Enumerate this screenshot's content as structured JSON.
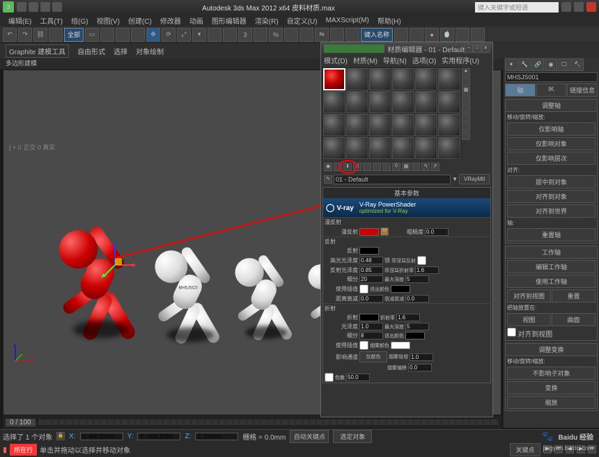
{
  "title": "Autodesk 3ds Max  2012 x64   皮料材质.max",
  "searchbox": "键入关键字或短语",
  "menubar": [
    "编辑(E)",
    "工具(T)",
    "组(G)",
    "视图(V)",
    "创建(C)",
    "修改器",
    "动画",
    "图形编辑器",
    "渲染(R)",
    "自定义(U)",
    "MAXScript(M)",
    "帮助(H)"
  ],
  "toolbar_dropdown": "全部",
  "toolbar_search": "键入名称",
  "ribbon_tabs": [
    "Graphite 建模工具",
    "自由形式",
    "选择",
    "对象绘制"
  ],
  "ribbon_sub": "多边形建模",
  "viewport_label": "[ + 0 正交 0 真实",
  "body_label": "MH5JSC0",
  "timeline_pos": "0 / 100",
  "mat_editor": {
    "title": "材质编辑器 - 01 - Default",
    "menu": [
      "模式(D)",
      "材质(M)",
      "导航(N)",
      "选项(O)",
      "实用程序(U)"
    ],
    "name": "01 - Default",
    "type_btn": "VRayMtl",
    "basic_params": "基本参数",
    "vray_brand": "V-ray",
    "vray_ps": "V-Ray PowerShader",
    "vray_opt": "optimized for V-Ray",
    "diffuse_section": "漫反射",
    "diffuse_label": "漫反射",
    "roughness_label": "粗糙度",
    "roughness_val": "0.0",
    "reflect_section": "反射",
    "reflect_label": "反射",
    "hilight_gloss_label": "高光光泽度",
    "hilight_gloss_val": "0.48",
    "reflect_gloss_label": "反射光泽度",
    "reflect_gloss_val": "0.85",
    "subdiv_label": "细分",
    "subdiv_val": "20",
    "use_interp": "使用插值",
    "dim_dist_label": "距离衰减",
    "dim_dist_val": "0.0",
    "lock_label": "锁",
    "fresnel_label": "菲涅耳反射",
    "fresnel_ior_label": "菲涅耳折射率",
    "fresnel_ior_val": "1.6",
    "max_depth_label": "最大深度",
    "max_depth_val": "5",
    "exit_color": "退出颜色",
    "dim_falloff": "衰减衰减",
    "dim_falloff_val": "0.0",
    "refract_section": "折射",
    "refract_label": "折射",
    "ior_label": "折射率",
    "ior_val": "1.6",
    "glossiness_label": "光泽度",
    "glossiness_val": "1.0",
    "refr_subdiv_label": "细分",
    "refr_subdiv_val": "8",
    "refr_exit": "退出颜色",
    "refr_max_depth": "最大深度",
    "refr_max_depth_val": "5",
    "use_interp2": "使用插值",
    "fog_color": "烟雾颜色",
    "affect_shadows": "影响通道",
    "affect_channels": "仅颜色",
    "fog_mult": "烟雾倍增",
    "fog_mult_val": "1.0",
    "fog_bias": "烟雾偏移",
    "fog_bias_val": "0.0",
    "abbe_label": "色散",
    "abbe_val": "50.0",
    "m_badge": "M"
  },
  "right_panel": {
    "name_field": "MHSJS001",
    "tab_pivot": "轴",
    "tab_ik": "IK",
    "tab_linkinfo": "链接信息",
    "r1_title": "调整轴",
    "r1_label": "移动/旋转/缩放:",
    "r1_b1": "仅影响轴",
    "r1_b2": "仅影响对象",
    "r1_b3": "仅影响层次",
    "align_title": "对齐:",
    "align_b1": "居中到对象",
    "align_b2": "对齐到对象",
    "align_b3": "对齐到世界",
    "pivot_title": "轴:",
    "pivot_b1": "重置轴",
    "r2_title": "工作轴",
    "r2_b1": "编辑工作轴",
    "r2_b2": "使用工作轴",
    "r2_b3": "对齐到视图",
    "r2_b3b": "重置",
    "r2_label": "把轴放置在:",
    "r2_b4": "视图",
    "r2_b5": "曲面",
    "r2_chk": "对齐到视图",
    "r3_title": "调整变换",
    "r3_label": "移动/旋转/缩放:",
    "r3_b1": "不影响子对象",
    "r3_b2": "变换",
    "r3_b3": "缩放"
  },
  "status": {
    "selection": "选择了 1 个对象",
    "hint": "单击并拖动以选择并移动对象",
    "x": "X: 460.55mm",
    "y": "Y: -309.383m",
    "z": "Z: 0.0mm",
    "grid": "栅格 = 0.0mm",
    "auto_key": "自动关键点",
    "selected": "选定对象",
    "set_key": "关键点",
    "red_tag": "所在行"
  },
  "watermark": {
    "brand": "Baidu 经验",
    "url": "jingyan.baidu.com"
  }
}
